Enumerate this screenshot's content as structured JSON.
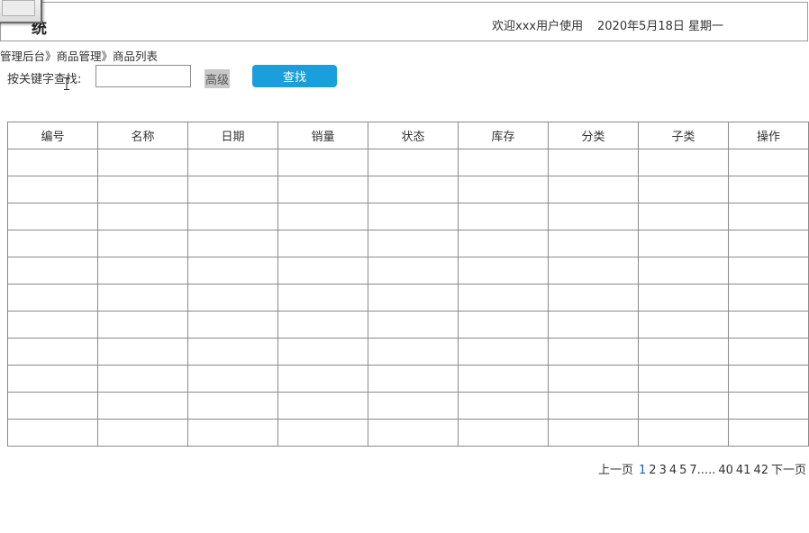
{
  "header": {
    "title": "统",
    "welcome": "欢迎xxx用户使用",
    "date": "2020年5月18日 星期一"
  },
  "breadcrumb": "管理后台》商品管理》商品列表",
  "search": {
    "label": "按关键字查找:",
    "input_value": "",
    "advanced_label": "高级",
    "button_label": "查找"
  },
  "table": {
    "columns": [
      "编号",
      "名称",
      "日期",
      "销量",
      "状态",
      "库存",
      "分类",
      "子类",
      "操作"
    ],
    "rows": [
      [
        "",
        "",
        "",
        "",
        "",
        "",
        "",
        "",
        ""
      ],
      [
        "",
        "",
        "",
        "",
        "",
        "",
        "",
        "",
        ""
      ],
      [
        "",
        "",
        "",
        "",
        "",
        "",
        "",
        "",
        ""
      ],
      [
        "",
        "",
        "",
        "",
        "",
        "",
        "",
        "",
        ""
      ],
      [
        "",
        "",
        "",
        "",
        "",
        "",
        "",
        "",
        ""
      ],
      [
        "",
        "",
        "",
        "",
        "",
        "",
        "",
        "",
        ""
      ],
      [
        "",
        "",
        "",
        "",
        "",
        "",
        "",
        "",
        ""
      ],
      [
        "",
        "",
        "",
        "",
        "",
        "",
        "",
        "",
        ""
      ],
      [
        "",
        "",
        "",
        "",
        "",
        "",
        "",
        "",
        ""
      ],
      [
        "",
        "",
        "",
        "",
        "",
        "",
        "",
        "",
        ""
      ],
      [
        "",
        "",
        "",
        "",
        "",
        "",
        "",
        "",
        ""
      ]
    ]
  },
  "pagination": {
    "prev": "上一页",
    "pages": [
      "1",
      "2",
      "3",
      "4",
      "5",
      "7.....",
      "40",
      "41",
      "42"
    ],
    "current": "1",
    "next": "下一页"
  },
  "colors": {
    "accent": "#1a9fdc",
    "current_page": "#1a5fc7",
    "border": "#8a8a8a"
  }
}
